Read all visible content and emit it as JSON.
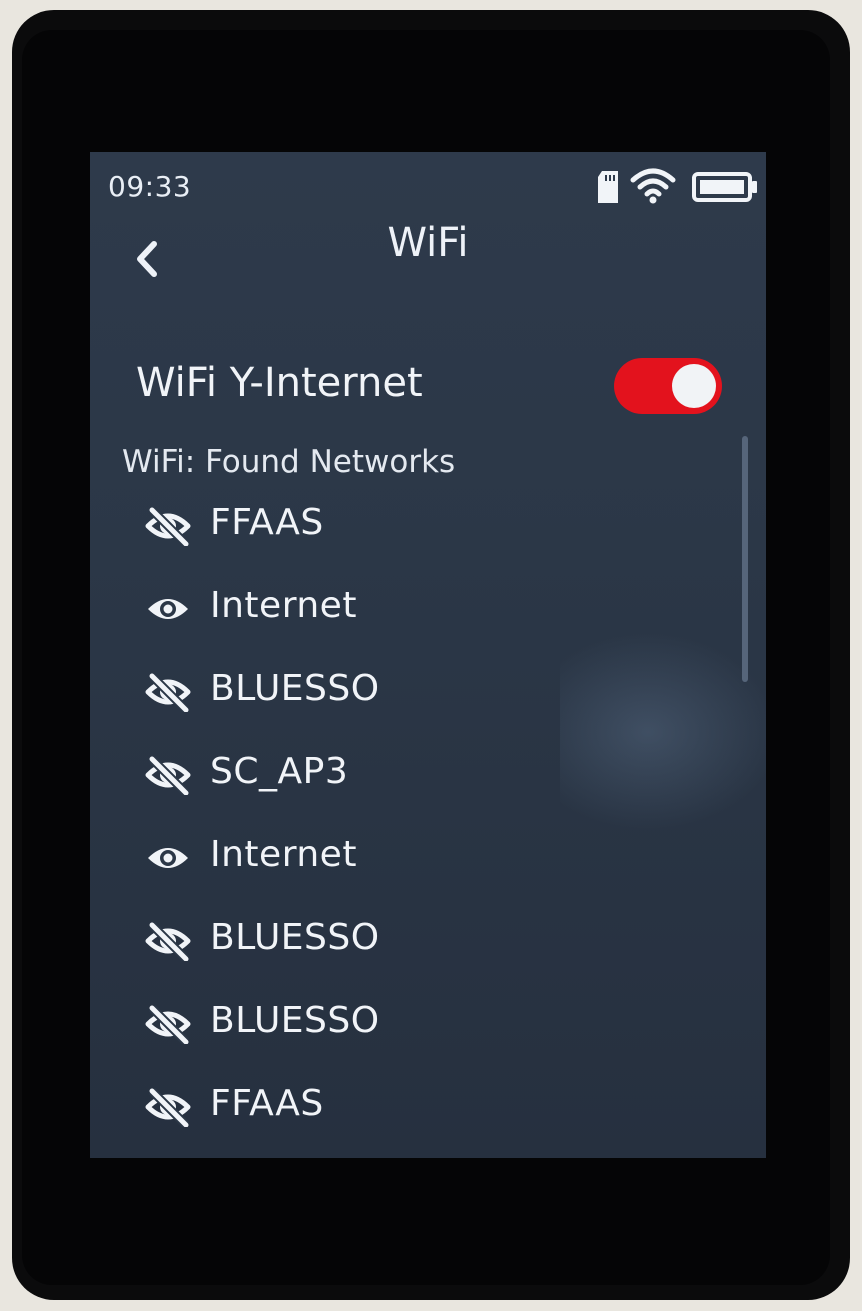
{
  "status_bar": {
    "time": "09:33",
    "icons": [
      "sd-card-icon",
      "wifi-icon",
      "battery-icon"
    ]
  },
  "header": {
    "title": "WiFi",
    "back_icon": "chevron-left-icon"
  },
  "wifi_toggle": {
    "label": "WiFi Y-Internet",
    "state": "on",
    "color": "#e3121d"
  },
  "networks": {
    "section_title": "WiFi: Found Networks",
    "items": [
      {
        "name": "FFAAS",
        "icon": "eye-off-icon"
      },
      {
        "name": "Internet",
        "icon": "eye-icon"
      },
      {
        "name": "BLUESSO",
        "icon": "eye-off-icon"
      },
      {
        "name": "SC_AP3",
        "icon": "eye-off-icon"
      },
      {
        "name": "Internet",
        "icon": "eye-icon"
      },
      {
        "name": "BLUESSO",
        "icon": "eye-off-icon"
      },
      {
        "name": "BLUESSO",
        "icon": "eye-off-icon"
      },
      {
        "name": "FFAAS",
        "icon": "eye-off-icon"
      }
    ]
  }
}
